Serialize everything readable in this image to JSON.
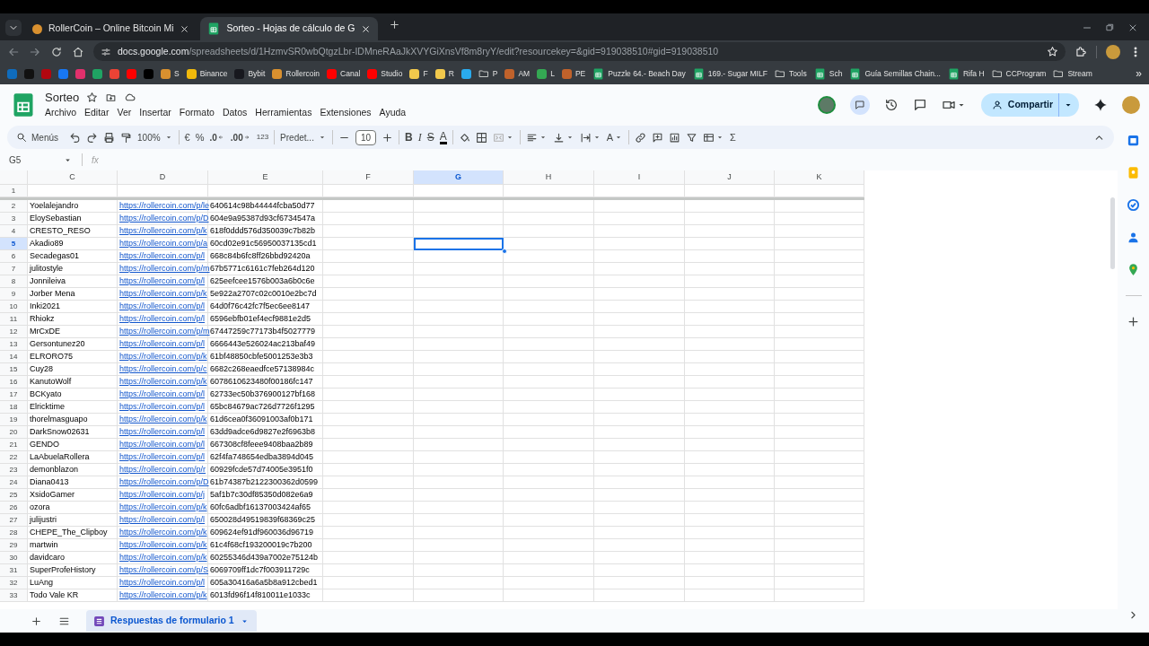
{
  "browser": {
    "tabs": [
      {
        "title": "RollerCoin – Online Bitcoin Mi",
        "kind": "site",
        "selected": false
      },
      {
        "title": "Sorteo - Hojas de cálculo de G",
        "kind": "sheet",
        "selected": true
      }
    ],
    "url": {
      "host": "docs.google.com",
      "path": "/spreadsheets/d/1HzmvSR0wbQtgzLbr-IDMneRAaJkXVYGiXnsVf8m8ryY/edit?resourcekey=&gid=919038510#gid=919038510"
    },
    "bookmarks": [
      {
        "kind": "site",
        "color": "#0f6cbd"
      },
      {
        "kind": "site",
        "color": "#111111"
      },
      {
        "kind": "site",
        "color": "#b20710"
      },
      {
        "kind": "site",
        "color": "#1877f2"
      },
      {
        "kind": "site",
        "color": "#e1306c"
      },
      {
        "kind": "site",
        "color": "#1fa463"
      },
      {
        "kind": "site",
        "color": "#ea4335"
      },
      {
        "kind": "site",
        "color": "#ff0000"
      },
      {
        "kind": "site",
        "color": "#000000"
      },
      {
        "kind": "site",
        "color": "#d9902f",
        "label": "S"
      },
      {
        "kind": "site",
        "color": "#f0b90b",
        "label": "Binance"
      },
      {
        "kind": "site",
        "color": "#17181e",
        "label": "Bybit"
      },
      {
        "kind": "site",
        "color": "#d9902f",
        "label": "Rollercoin"
      },
      {
        "kind": "site",
        "color": "#ff0000",
        "label": "Canal"
      },
      {
        "kind": "site",
        "color": "#ff0000",
        "label": "Studio"
      },
      {
        "kind": "site",
        "color": "#f2c94c",
        "label": "F"
      },
      {
        "kind": "site",
        "color": "#f2c94c",
        "label": "R"
      },
      {
        "kind": "site",
        "color": "#2aabee"
      },
      {
        "kind": "folder",
        "label": "P"
      },
      {
        "kind": "site",
        "color": "#c0622b",
        "label": "AM"
      },
      {
        "kind": "site",
        "color": "#34a853",
        "label": "L"
      },
      {
        "kind": "site",
        "color": "#c0622b",
        "label": "PE"
      },
      {
        "kind": "sheet",
        "label": "Puzzle 64.- Beach Day"
      },
      {
        "kind": "sheet",
        "label": "169.- Sugar MILF"
      },
      {
        "kind": "folder",
        "label": "Tools"
      },
      {
        "kind": "sheet",
        "label": "Sch"
      },
      {
        "kind": "sheet",
        "label": "Guía Semillas Chain..."
      },
      {
        "kind": "sheet",
        "label": "Rifa H"
      },
      {
        "kind": "folder",
        "label": "CCProgram"
      },
      {
        "kind": "folder",
        "label": "Stream"
      }
    ],
    "bookmarks_overflow": "»"
  },
  "document": {
    "title": "Sorteo",
    "share_button": "Compartir",
    "menu": [
      "Archivo",
      "Editar",
      "Ver",
      "Insertar",
      "Formato",
      "Datos",
      "Herramientas",
      "Extensiones",
      "Ayuda"
    ]
  },
  "toolbar": [
    {
      "kind": "search",
      "label": "Menús"
    },
    {
      "kind": "undo"
    },
    {
      "kind": "redo"
    },
    {
      "kind": "print"
    },
    {
      "kind": "paint-format"
    },
    {
      "kind": "dropdown",
      "label": "100%"
    },
    {
      "kind": "divider"
    },
    {
      "kind": "text",
      "label": "€"
    },
    {
      "kind": "text",
      "label": "%"
    },
    {
      "kind": "decimal-decrease",
      "label": ".0"
    },
    {
      "kind": "decimal-increase",
      "label": ".00"
    },
    {
      "kind": "text",
      "label": "123"
    },
    {
      "kind": "divider"
    },
    {
      "kind": "dropdown",
      "label": "Predet..."
    },
    {
      "kind": "divider"
    },
    {
      "kind": "minus"
    },
    {
      "kind": "field",
      "label": "10"
    },
    {
      "kind": "plus"
    },
    {
      "kind": "divider"
    },
    {
      "kind": "bold",
      "label": "B"
    },
    {
      "kind": "italic",
      "label": "I"
    },
    {
      "kind": "strike",
      "label": "S"
    },
    {
      "kind": "text-color",
      "label": "A"
    },
    {
      "kind": "divider"
    },
    {
      "kind": "fill"
    },
    {
      "kind": "borders"
    },
    {
      "kind": "merge"
    },
    {
      "kind": "divider"
    },
    {
      "kind": "align"
    },
    {
      "kind": "valign"
    },
    {
      "kind": "wrap"
    },
    {
      "kind": "rotate",
      "label": "A"
    },
    {
      "kind": "divider"
    },
    {
      "kind": "link"
    },
    {
      "kind": "comment"
    },
    {
      "kind": "chart"
    },
    {
      "kind": "filter"
    },
    {
      "kind": "table-view"
    },
    {
      "kind": "sigma",
      "label": "Σ"
    }
  ],
  "formula_bar": {
    "name_box": "G5",
    "fx": "fx"
  },
  "sheet": {
    "columns": [
      {
        "label": "C",
        "kind": "text",
        "selected": false
      },
      {
        "label": "D",
        "kind": "link",
        "selected": false
      },
      {
        "label": "E",
        "kind": "text",
        "selected": false
      },
      {
        "label": "F",
        "selected": false
      },
      {
        "label": "G",
        "selected": true
      },
      {
        "label": "H",
        "selected": false
      },
      {
        "label": "I",
        "selected": false
      },
      {
        "label": "J",
        "selected": false
      },
      {
        "label": "K",
        "selected": false
      }
    ],
    "rows": [
      {
        "number": "1",
        "selected": false,
        "cells": []
      },
      {
        "number": "2",
        "selected": false,
        "cells": [
          "Yoelalejandro",
          "https://rollercoin.com/p/le",
          "640614c98b44444fcba50d77"
        ]
      },
      {
        "number": "3",
        "selected": false,
        "cells": [
          "EloySebastian",
          "https://rollercoin.com/p/D",
          "604e9a95387d93cf6734547a"
        ]
      },
      {
        "number": "4",
        "selected": false,
        "cells": [
          "CRESTO_RESO",
          "https://rollercoin.com/p/k",
          "618f0ddd576d350039c7b82b"
        ]
      },
      {
        "number": "5",
        "selected": true,
        "cells": [
          "Akadio89",
          "https://rollercoin.com/p/a",
          "60cd02e91c56950037135cd1"
        ]
      },
      {
        "number": "6",
        "selected": false,
        "cells": [
          "Secadegas01",
          "https://rollercoin.com/p/l",
          "668c84b6fc8ff26bbd92420a"
        ]
      },
      {
        "number": "7",
        "selected": false,
        "cells": [
          "julitostyle",
          "https://rollercoin.com/p/m",
          "67b5771c6161c7feb264d120"
        ]
      },
      {
        "number": "8",
        "selected": false,
        "cells": [
          "Jonnileiva",
          "https://rollercoin.com/p/l",
          "625eefcee1576b003a6b0c6e"
        ]
      },
      {
        "number": "9",
        "selected": false,
        "cells": [
          "Jorber Mena",
          "https://rollercoin.com/p/k",
          "5e922a2707c02c0010e2bc7d"
        ]
      },
      {
        "number": "10",
        "selected": false,
        "cells": [
          "Inki2021",
          "https://rollercoin.com/p/l",
          "64d0f76c42fc7f5ec6ee8147"
        ]
      },
      {
        "number": "11",
        "selected": false,
        "cells": [
          "Rhiokz",
          "https://rollercoin.com/p/l",
          "6596ebfb01ef4ecf9881e2d5"
        ]
      },
      {
        "number": "12",
        "selected": false,
        "cells": [
          "MrCxDE",
          "https://rollercoin.com/p/m",
          "67447259c77173b4f5027779"
        ]
      },
      {
        "number": "13",
        "selected": false,
        "cells": [
          "Gersontunez20",
          "https://rollercoin.com/p/l",
          "6666443e526024ac213baf49"
        ]
      },
      {
        "number": "14",
        "selected": false,
        "cells": [
          "ELRORO75",
          "https://rollercoin.com/p/k",
          "61bf48850cbfe5001253e3b3"
        ]
      },
      {
        "number": "15",
        "selected": false,
        "cells": [
          "Cuy28",
          "https://rollercoin.com/p/c",
          "6682c268eaedfce57138984c"
        ]
      },
      {
        "number": "16",
        "selected": false,
        "cells": [
          "KanutoWolf",
          "https://rollercoin.com/p/k",
          "6078610623480f00186fc147"
        ]
      },
      {
        "number": "17",
        "selected": false,
        "cells": [
          "BCKyato",
          "https://rollercoin.com/p/l",
          "62733ec50b376900127bf168"
        ]
      },
      {
        "number": "18",
        "selected": false,
        "cells": [
          "Elricktime",
          "https://rollercoin.com/p/l",
          "65bc84679ac726d7726f1295"
        ]
      },
      {
        "number": "19",
        "selected": false,
        "cells": [
          "thorelmasguapo",
          "https://rollercoin.com/p/k",
          "61d6cea0f36091003af0b171"
        ]
      },
      {
        "number": "20",
        "selected": false,
        "cells": [
          "DarkSnow02631",
          "https://rollercoin.com/p/l",
          "63dd9adce6d9827e2f6963b8"
        ]
      },
      {
        "number": "21",
        "selected": false,
        "cells": [
          "GENDO",
          "https://rollercoin.com/p/l",
          "667308cf8feee9408baa2b89"
        ]
      },
      {
        "number": "22",
        "selected": false,
        "cells": [
          "LaAbuelaRollera",
          "https://rollercoin.com/p/l",
          "62f4fa748654edba3894d045"
        ]
      },
      {
        "number": "23",
        "selected": false,
        "cells": [
          "demonblazon",
          "https://rollercoin.com/p/r",
          "60929fcde57d74005e3951f0"
        ]
      },
      {
        "number": "24",
        "selected": false,
        "cells": [
          "Diana0413",
          "https://rollercoin.com/p/D",
          "61b74387b2122300362d0599"
        ]
      },
      {
        "number": "25",
        "selected": false,
        "cells": [
          "XsidoGamer",
          "https://rollercoin.com/p/j",
          "5af1b7c30df85350d082e6a9"
        ]
      },
      {
        "number": "26",
        "selected": false,
        "cells": [
          "ozora",
          "https://rollercoin.com/p/k",
          "60fc6adbf16137003424af65"
        ]
      },
      {
        "number": "27",
        "selected": false,
        "cells": [
          "julijustri",
          "https://rollercoin.com/p/l",
          "650028d49519839f68369c25"
        ]
      },
      {
        "number": "28",
        "selected": false,
        "cells": [
          "CHEPE_The_Clipboy",
          "https://rollercoin.com/p/k",
          "609624ef91df960036d96719"
        ]
      },
      {
        "number": "29",
        "selected": false,
        "cells": [
          "martwin",
          "https://rollercoin.com/p/k",
          "61c4f68cf193200019c7b200"
        ]
      },
      {
        "number": "30",
        "selected": false,
        "cells": [
          "davidcaro",
          "https://rollercoin.com/p/k",
          "60255346d439a7002e75124b"
        ]
      },
      {
        "number": "31",
        "selected": false,
        "cells": [
          "SuperProfeHistory",
          "https://rollercoin.com/p/S",
          "6069709ff1dc7f003911729c"
        ]
      },
      {
        "number": "32",
        "selected": false,
        "cells": [
          "LuAng",
          "https://rollercoin.com/p/l",
          "605a30416a6a5b8a912cbed1"
        ]
      },
      {
        "number": "33",
        "selected": false,
        "cells": [
          "Todo Vale KR",
          "https://rollercoin.com/p/k",
          "6013fd96f14f810011e1033c"
        ]
      }
    ]
  },
  "sheet_tabs": [
    {
      "label": "Respuestas de formulario 1",
      "selected": true
    }
  ]
}
